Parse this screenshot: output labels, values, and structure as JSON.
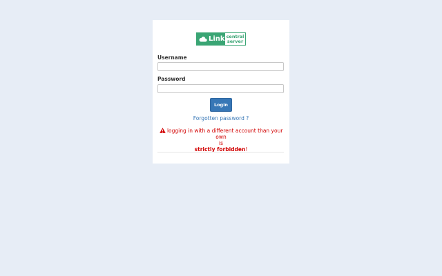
{
  "logo": {
    "icon": "cloud-icon",
    "word": "Link",
    "subtitle_line1": "central",
    "subtitle_line2": "server",
    "brand_color": "#3aa574"
  },
  "form": {
    "username_label": "Username",
    "username_value": "",
    "password_label": "Password",
    "password_value": "",
    "login_label": "Login",
    "forgot_link": "Forgotten password ?"
  },
  "warning": {
    "icon": "warning-triangle-icon",
    "text_line1": "logging in with a different account than your own",
    "text_line2": "is",
    "strong_text": "strictly forbidden",
    "trailing": "!",
    "color": "#d20000"
  },
  "colors": {
    "background": "#e7edf6",
    "button": "#3777b6",
    "link": "#3777b6"
  }
}
